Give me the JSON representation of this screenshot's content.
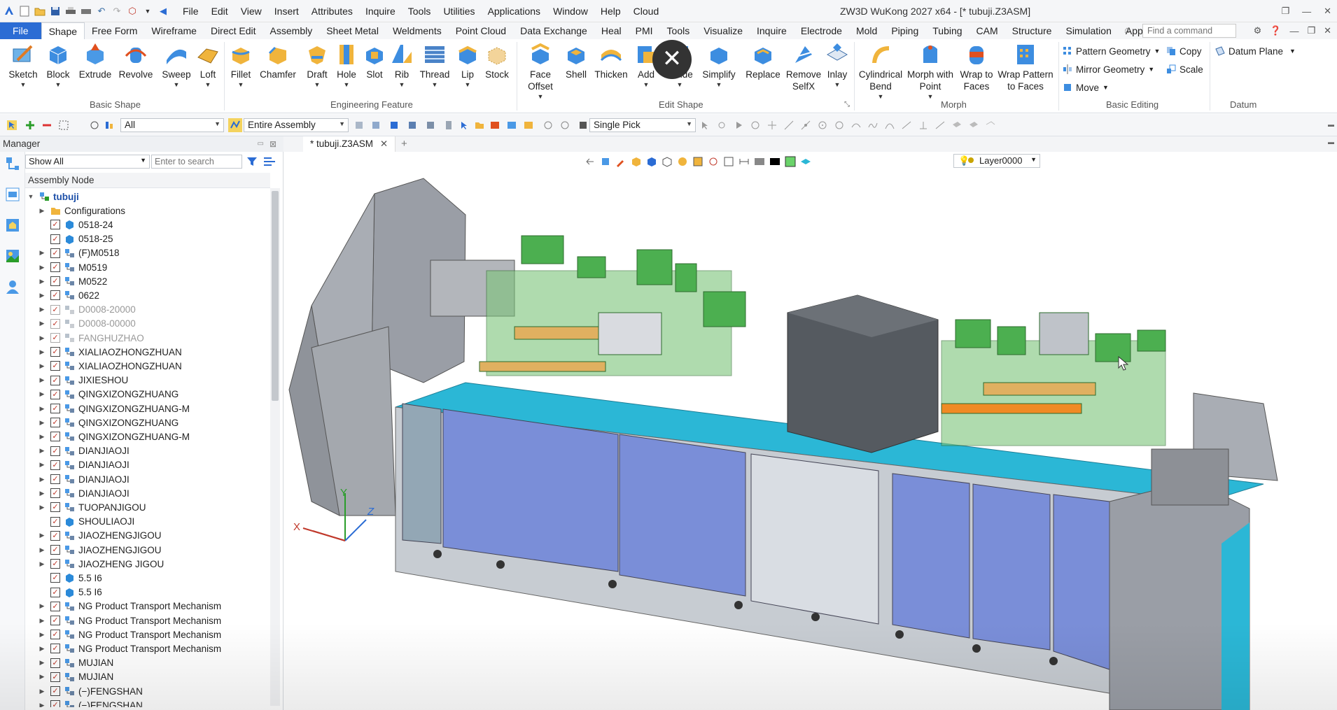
{
  "window": {
    "title": "ZW3D WuKong 2027  x64 - [* tubuji.Z3ASM]"
  },
  "menu": [
    "File",
    "Edit",
    "View",
    "Insert",
    "Attributes",
    "Inquire",
    "Tools",
    "Utilities",
    "Applications",
    "Window",
    "Help",
    "Cloud"
  ],
  "ribbon_tabs": [
    "File",
    "Shape",
    "Free Form",
    "Wireframe",
    "Direct Edit",
    "Assembly",
    "Sheet Metal",
    "Weldments",
    "Point Cloud",
    "Data Exchange",
    "Heal",
    "PMI",
    "Tools",
    "Visualize",
    "Inquire",
    "Electrode",
    "Mold",
    "Piping",
    "Tubing",
    "CAM",
    "Structure",
    "Simulation",
    "App"
  ],
  "active_ribbon_tab": "Shape",
  "command_search": {
    "placeholder": "Find a command"
  },
  "ribbon": {
    "basic_shape": {
      "label": "Basic Shape",
      "buttons": [
        "Sketch",
        "Block",
        "Extrude",
        "Revolve",
        "Sweep",
        "Loft"
      ]
    },
    "engineering_feature": {
      "label": "Engineering Feature",
      "buttons": [
        "Fillet",
        "Chamfer",
        "Draft",
        "Hole",
        "Slot",
        "Rib",
        "Thread",
        "Lip",
        "Stock"
      ]
    },
    "edit_shape": {
      "label": "Edit Shape",
      "buttons": [
        "Face Offset",
        "Shell",
        "Thicken",
        "Add",
        "Divide",
        "Simplify",
        "Replace",
        "Remove SelfX",
        "Inlay"
      ]
    },
    "morph": {
      "label": "Morph",
      "buttons": [
        "Cylindrical Bend",
        "Morph with Point",
        "Wrap to Faces",
        "Wrap Pattern to Faces"
      ]
    },
    "basic_editing": {
      "label": "Basic Editing",
      "items": [
        "Pattern Geometry",
        "Mirror Geometry",
        "Move",
        "Copy",
        "Scale"
      ]
    },
    "datum": {
      "label": "Datum",
      "items": [
        "Datum Plane"
      ]
    }
  },
  "toolbar2": {
    "filter": "All",
    "scope": "Entire Assembly",
    "pick_mode": "Single Pick"
  },
  "manager": {
    "title": "Manager",
    "filter": "Show All",
    "search_placeholder": "Enter to search",
    "column": "Assembly Node",
    "root": "tubuji",
    "nodes": [
      {
        "label": "Configurations",
        "type": "folder",
        "expand": true,
        "check": false
      },
      {
        "label": "0518-24",
        "type": "part",
        "expand": false,
        "check": true
      },
      {
        "label": "0518-25",
        "type": "part",
        "expand": false,
        "check": true
      },
      {
        "label": "(F)M0518",
        "type": "asm",
        "expand": true,
        "check": true
      },
      {
        "label": "M0519",
        "type": "asm",
        "expand": true,
        "check": true
      },
      {
        "label": "M0522",
        "type": "asm",
        "expand": true,
        "check": true
      },
      {
        "label": "0622",
        "type": "asm",
        "expand": true,
        "check": true
      },
      {
        "label": "D0008-20000",
        "type": "asm",
        "expand": true,
        "check": true,
        "dim": true
      },
      {
        "label": "D0008-00000",
        "type": "asm",
        "expand": true,
        "check": true,
        "dim": true
      },
      {
        "label": "FANGHUZHAO",
        "type": "asm",
        "expand": true,
        "check": true,
        "dim": true
      },
      {
        "label": "XIALIAOZHONGZHUAN",
        "type": "asm",
        "expand": true,
        "check": true
      },
      {
        "label": "XIALIAOZHONGZHUAN",
        "type": "asm",
        "expand": true,
        "check": true
      },
      {
        "label": "JIXIESHOU",
        "type": "asm",
        "expand": true,
        "check": true
      },
      {
        "label": "QINGXIZONGZHUANG",
        "type": "asm",
        "expand": true,
        "check": true
      },
      {
        "label": "QINGXIZONGZHUANG-M",
        "type": "asm",
        "expand": true,
        "check": true
      },
      {
        "label": "QINGXIZONGZHUANG",
        "type": "asm",
        "expand": true,
        "check": true
      },
      {
        "label": "QINGXIZONGZHUANG-M",
        "type": "asm",
        "expand": true,
        "check": true
      },
      {
        "label": "DIANJIAOJI",
        "type": "asm",
        "expand": true,
        "check": true
      },
      {
        "label": "DIANJIAOJI",
        "type": "asm",
        "expand": true,
        "check": true
      },
      {
        "label": "DIANJIAOJI",
        "type": "asm",
        "expand": true,
        "check": true
      },
      {
        "label": "DIANJIAOJI",
        "type": "asm",
        "expand": true,
        "check": true
      },
      {
        "label": "TUOPANJIGOU",
        "type": "asm",
        "expand": true,
        "check": true
      },
      {
        "label": "SHOULIAOJI",
        "type": "part",
        "expand": false,
        "check": true
      },
      {
        "label": "JIAOZHENGJIGOU",
        "type": "asm",
        "expand": true,
        "check": true
      },
      {
        "label": "JIAOZHENGJIGOU",
        "type": "asm",
        "expand": true,
        "check": true
      },
      {
        "label": "JIAOZHENG JIGOU",
        "type": "asm",
        "expand": true,
        "check": true
      },
      {
        "label": "5.5 I6",
        "type": "part",
        "expand": false,
        "check": true
      },
      {
        "label": "5.5 I6",
        "type": "part",
        "expand": false,
        "check": true
      },
      {
        "label": "NG Product Transport Mechanism",
        "type": "asm",
        "expand": true,
        "check": true
      },
      {
        "label": "NG Product Transport Mechanism",
        "type": "asm",
        "expand": true,
        "check": true
      },
      {
        "label": "NG Product Transport Mechanism",
        "type": "asm",
        "expand": true,
        "check": true
      },
      {
        "label": "NG Product Transport Mechanism",
        "type": "asm",
        "expand": true,
        "check": true
      },
      {
        "label": "MUJIAN",
        "type": "asm",
        "expand": true,
        "check": true
      },
      {
        "label": "MUJIAN",
        "type": "asm",
        "expand": true,
        "check": true
      },
      {
        "label": "(−)FENGSHAN",
        "type": "asm",
        "expand": true,
        "check": true
      },
      {
        "label": "(−)FENGSHAN",
        "type": "asm",
        "expand": true,
        "check": true
      }
    ]
  },
  "document": {
    "tab": "* tubuji.Z3ASM",
    "layer": "Layer0000"
  },
  "triad": {
    "x": "X",
    "y": "Y",
    "z": "Z"
  },
  "colors": {
    "accent": "#2b6cd4",
    "cabinet_blue": "#7a8ed8",
    "table_cyan": "#2bb7d6",
    "frame_gray": "#8d9096",
    "green_parts": "#4caf50"
  }
}
